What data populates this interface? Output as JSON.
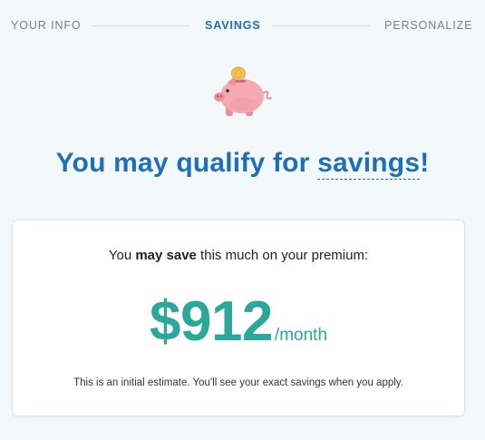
{
  "stepper": {
    "steps": [
      {
        "label": "YOUR INFO",
        "state": "inactive"
      },
      {
        "label": "SAVINGS",
        "state": "active"
      },
      {
        "label": "PERSONALIZE",
        "state": "inactive"
      }
    ]
  },
  "illustration": {
    "icon": "piggy-bank-icon",
    "colors": {
      "pig": "#f4a3ad",
      "coin": "#f2c45a"
    }
  },
  "headline": {
    "prefix": "You may qualify for ",
    "highlight": "savings",
    "suffix": "!"
  },
  "card": {
    "intro_prefix": "You ",
    "intro_bold": "may save",
    "intro_suffix": " this much on your premium:",
    "amount": "$912",
    "period": "/month",
    "note": "This is an initial estimate. You'll see your exact savings when you apply."
  },
  "colors": {
    "primary": "#1f6fb8",
    "accent": "#2ba89a",
    "background": "#f3f8fb"
  }
}
